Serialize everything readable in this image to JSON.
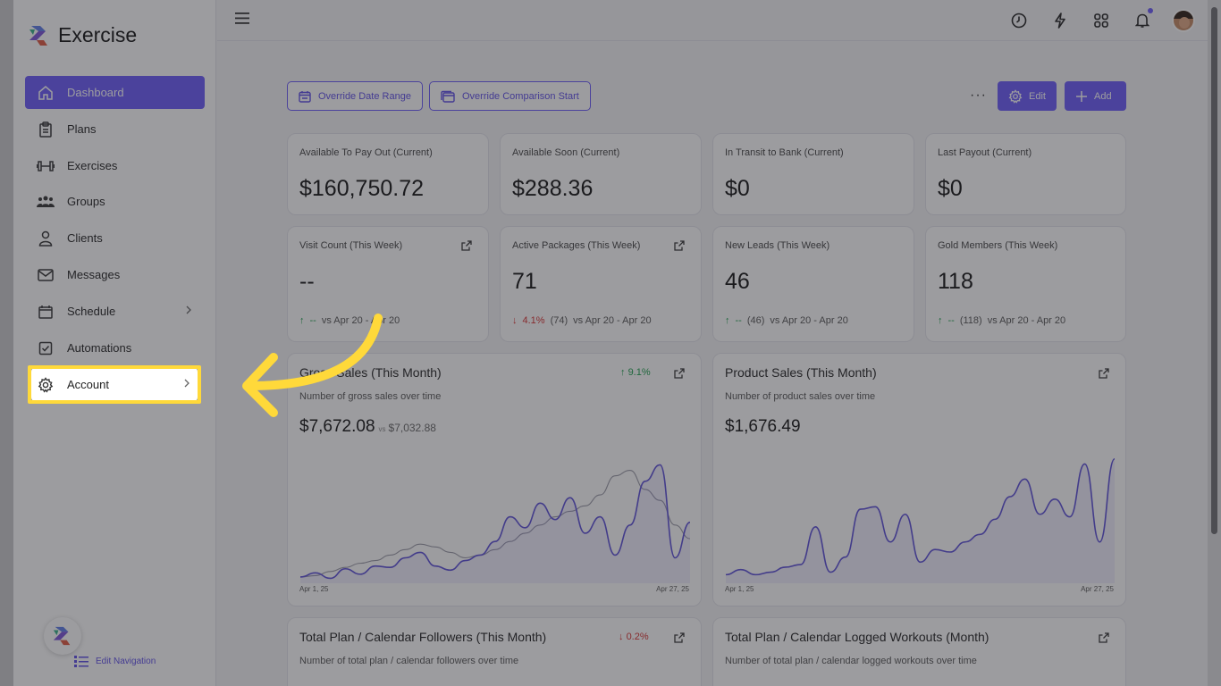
{
  "brand": {
    "name": "Exercise"
  },
  "sidebar": {
    "items": [
      {
        "label": "Dashboard",
        "icon": "home-icon",
        "active": true
      },
      {
        "label": "Plans",
        "icon": "clipboard-icon"
      },
      {
        "label": "Exercises",
        "icon": "dumbbell-icon"
      },
      {
        "label": "Groups",
        "icon": "users-icon"
      },
      {
        "label": "Clients",
        "icon": "user-icon"
      },
      {
        "label": "Messages",
        "icon": "mail-icon"
      },
      {
        "label": "Schedule",
        "icon": "calendar-icon",
        "has_submenu": true
      },
      {
        "label": "Automations",
        "icon": "checkbox-icon"
      },
      {
        "label": "Account",
        "icon": "gear-icon",
        "has_submenu": true,
        "highlighted": true
      }
    ],
    "edit_navigation": "Edit Navigation"
  },
  "header": {
    "icons": [
      "clock-icon",
      "bolt-icon",
      "apps-grid-icon",
      "bell-icon",
      "avatar"
    ]
  },
  "toolbar": {
    "override_date_range": "Override Date Range",
    "override_comparison_start": "Override Comparison Start",
    "more": "···",
    "edit": "Edit",
    "add": "Add"
  },
  "kpis_top": [
    {
      "label": "Available To Pay Out (Current)",
      "value": "$160,750.72"
    },
    {
      "label": "Available Soon (Current)",
      "value": "$288.36"
    },
    {
      "label": "In Transit to Bank (Current)",
      "value": "$0"
    },
    {
      "label": "Last Payout (Current)",
      "value": "$0"
    }
  ],
  "kpis_week": [
    {
      "label": "Visit Count (This Week)",
      "value": "--",
      "trend": "up",
      "change": "--",
      "prev": "",
      "range": "vs Apr 20 - Apr 20"
    },
    {
      "label": "Active Packages (This Week)",
      "value": "71",
      "trend": "down",
      "change": "4.1%",
      "prev": "(74)",
      "range": "vs Apr 20 - Apr 20"
    },
    {
      "label": "New Leads (This Week)",
      "value": "46",
      "trend": "up",
      "change": "--",
      "prev": "(46)",
      "range": "vs Apr 20 - Apr 20"
    },
    {
      "label": "Gold Members (This Week)",
      "value": "118",
      "trend": "up",
      "change": "--",
      "prev": "(118)",
      "range": "vs Apr 20 - Apr 20"
    }
  ],
  "charts": {
    "gross": {
      "title": "Gross Sales (This Month)",
      "subtitle": "Number of gross sales over time",
      "value": "$7,672.08",
      "vs_label": "vs",
      "vs_value": "$7,032.88",
      "change": "9.1%",
      "x_start": "Apr 1, 25",
      "x_end": "Apr 27, 25"
    },
    "product": {
      "title": "Product Sales (This Month)",
      "subtitle": "Number of product sales over time",
      "value": "$1,676.49",
      "x_start": "Apr 1, 25",
      "x_end": "Apr 27, 25"
    },
    "followers": {
      "title": "Total Plan / Calendar Followers (This Month)",
      "subtitle": "Number of total plan / calendar followers over time",
      "change": "0.2%"
    },
    "workouts": {
      "title": "Total Plan / Calendar Logged Workouts (Month)",
      "subtitle": "Number of total plan / calendar logged workouts over time"
    }
  },
  "chart_data": [
    {
      "type": "line",
      "title": "Gross Sales (This Month)",
      "x_range": [
        "Apr 1, 25",
        "Apr 27, 25"
      ],
      "series": [
        {
          "values": [
            2,
            5,
            1,
            8,
            4,
            10,
            9,
            16,
            20,
            10,
            7,
            14,
            18,
            28,
            46,
            38,
            56,
            44,
            60,
            34,
            46,
            18,
            40,
            72,
            84,
            16,
            42
          ]
        },
        {
          "values": [
            2,
            3,
            6,
            9,
            12,
            14,
            18,
            22,
            26,
            24,
            20,
            16,
            18,
            22,
            28,
            34,
            40,
            46,
            50,
            54,
            62,
            76,
            80,
            66,
            58,
            40,
            30
          ]
        }
      ],
      "colors": [
        "#5b4fd9",
        "#9a9aa6"
      ]
    },
    {
      "type": "area",
      "title": "Product Sales (This Month)",
      "x_range": [
        "Apr 1, 25",
        "Apr 27, 25"
      ],
      "series": [
        {
          "values": [
            4,
            8,
            4,
            6,
            10,
            12,
            42,
            6,
            18,
            56,
            58,
            30,
            52,
            14,
            24,
            22,
            30,
            36,
            48,
            66,
            80,
            52,
            64,
            50,
            92,
            30,
            96
          ]
        }
      ],
      "colors": [
        "#5b4fd9"
      ]
    }
  ],
  "colors": {
    "accent": "#6a5af9",
    "highlight": "#ffd93a",
    "up": "#1a9e4a",
    "down": "#d93030"
  }
}
